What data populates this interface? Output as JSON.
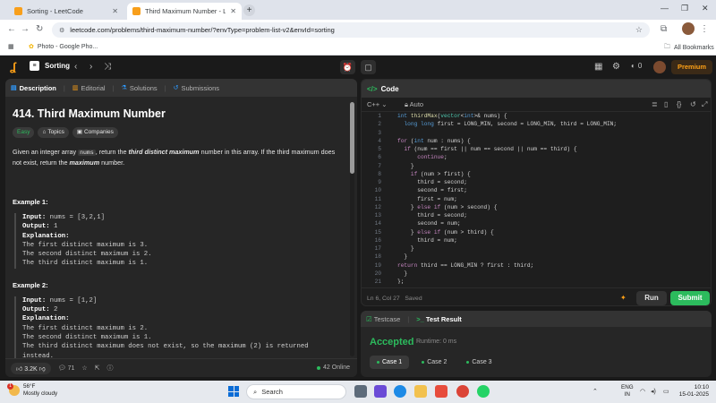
{
  "browser": {
    "tabs": [
      {
        "title": "Sorting - LeetCode",
        "active": false
      },
      {
        "title": "Third Maximum Number - LeetCode",
        "active": true
      }
    ],
    "url": "leetcode.com/problems/third-maximum-number/?envType=problem-list-v2&envId=sorting",
    "bookmark": "Photo - Google Pho...",
    "all_bookmarks": "All Bookmarks"
  },
  "header": {
    "list_name": "Sorting",
    "streak": "0",
    "premium": "Premium"
  },
  "left": {
    "tabs": [
      "Description",
      "Editorial",
      "Solutions",
      "Submissions"
    ],
    "title": "414. Third Maximum Number",
    "chips": [
      "Easy",
      "Topics",
      "Companies"
    ],
    "desc_1": "Given an integer array ",
    "desc_code": "nums",
    "desc_2": ", return the ",
    "desc_bold1": "third distinct maximum",
    "desc_3": " number in this array. If the third maximum does not exist, return the ",
    "desc_bold2": "maximum",
    "desc_4": " number.",
    "examples": [
      {
        "title": "Example 1:",
        "input_label": "Input:",
        "input": " nums = [3,2,1]",
        "output_label": "Output:",
        "output": " 1",
        "expl_label": "Explanation:",
        "expl": "The first distinct maximum is 3.\nThe second distinct maximum is 2.\nThe third distinct maximum is 1."
      },
      {
        "title": "Example 2:",
        "input_label": "Input:",
        "input": " nums = [1,2]",
        "output_label": "Output:",
        "output": " 2",
        "expl_label": "Explanation:",
        "expl": "The first distinct maximum is 2.\nThe second distinct maximum is 1.\nThe third distinct maximum does not exist, so the maximum (2) is returned\ninstead."
      }
    ],
    "likes": "3.2K",
    "comments": "71",
    "online": "42 Online"
  },
  "code": {
    "title": "Code",
    "language": "C++",
    "mode": "Auto",
    "cursor": "Ln 6, Col 27",
    "saved": "Saved",
    "run": "Run",
    "submit": "Submit",
    "line_numbers": [
      "1",
      "2",
      "3",
      "4",
      "5",
      "6",
      "7",
      "8",
      "9",
      "10",
      "11",
      "12",
      "13",
      "14",
      "15",
      "16",
      "17",
      "18",
      "19",
      "20",
      "21",
      "22",
      "23"
    ],
    "lines": [
      "int thirdMax(vector<int>& nums) {",
      "  long long first = LONG_MIN, second = LONG_MIN, third = LONG_MIN;",
      "",
      "  for (int num : nums) {",
      "    if (num == first || num == second || num == third) {",
      "      continue;",
      "    }",
      "    if (num > first) {",
      "      third = second;",
      "      second = first;",
      "      first = num;",
      "    } else if (num > second) {",
      "      third = second;",
      "      second = num;",
      "    } else if (num > third) {",
      "      third = num;",
      "    }",
      "  }",
      "  return third == LONG_MIN ? first : third;",
      "  }",
      "};"
    ]
  },
  "result": {
    "tabs": [
      "Testcase",
      "Test Result"
    ],
    "status": "Accepted",
    "runtime": "Runtime: 0 ms",
    "cases": [
      "Case 1",
      "Case 2",
      "Case 3"
    ]
  },
  "taskbar": {
    "temp": "56°F",
    "weather": "Mostly cloudy",
    "weather_badge": "1",
    "search": "Search",
    "lang1": "ENG",
    "lang2": "IN",
    "time": "10:10",
    "date": "15-01-2025"
  },
  "colors": {
    "accent": "#ffa116",
    "accepted": "#2cbb5d",
    "submit": "#2cbb5d"
  }
}
